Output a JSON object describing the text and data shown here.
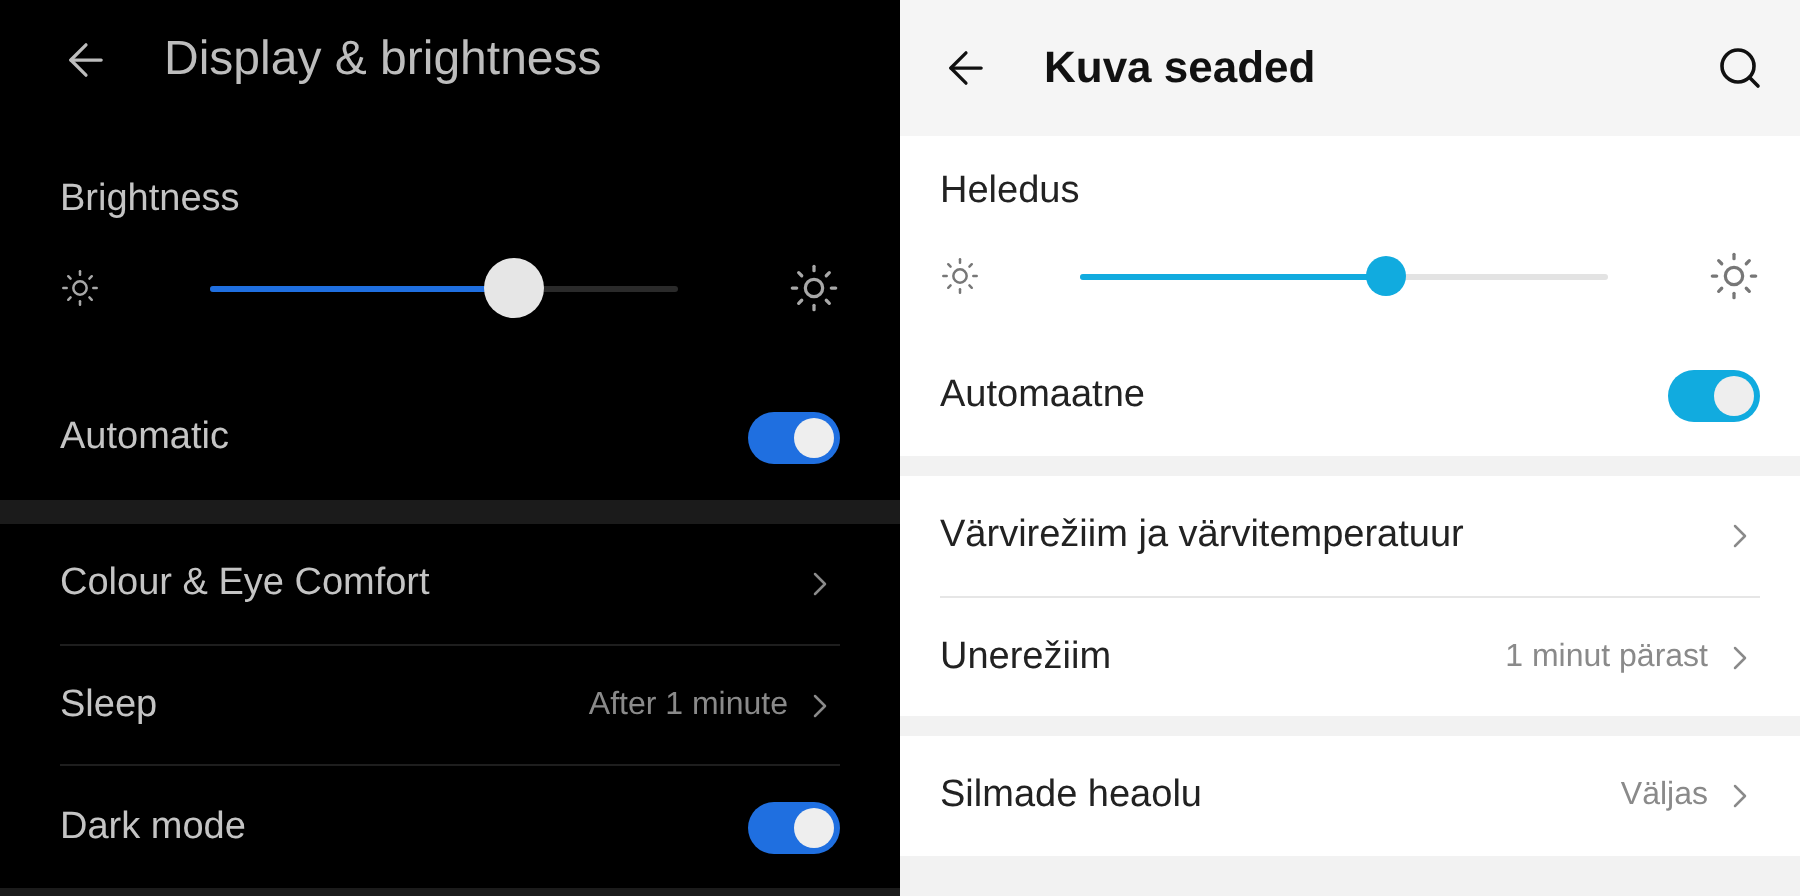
{
  "panels": [
    {
      "kind": "dark",
      "header": {
        "title": "Display & brightness"
      },
      "groups": [
        {
          "items": [
            {
              "kind": "slider",
              "label": "Brightness",
              "level": 0.65
            },
            {
              "kind": "toggle",
              "label": "Automatic",
              "on": true
            }
          ]
        },
        {
          "items": [
            {
              "kind": "link",
              "label": "Colour & Eye Comfort"
            },
            {
              "kind": "link",
              "label": "Sleep",
              "value": "After 1 minute"
            },
            {
              "kind": "toggle",
              "label": "Dark mode",
              "on": true
            }
          ]
        }
      ]
    },
    {
      "kind": "light",
      "header": {
        "title": "Kuva seaded",
        "actions": [
          {
            "kind": "search"
          }
        ]
      },
      "groups": [
        {
          "items": [
            {
              "kind": "slider",
              "label": "Heledus",
              "level": 0.58
            },
            {
              "kind": "toggle",
              "label": "Automaatne",
              "on": true
            }
          ]
        },
        {
          "items": [
            {
              "kind": "link",
              "label": "Värvirežiim ja värvitemperatuur"
            },
            {
              "kind": "link",
              "label": "Unerežiim",
              "value": "1 minut pärast"
            }
          ]
        },
        {
          "items": [
            {
              "kind": "link",
              "label": "Silmade heaolu",
              "value": "Väljas"
            }
          ]
        }
      ]
    }
  ]
}
